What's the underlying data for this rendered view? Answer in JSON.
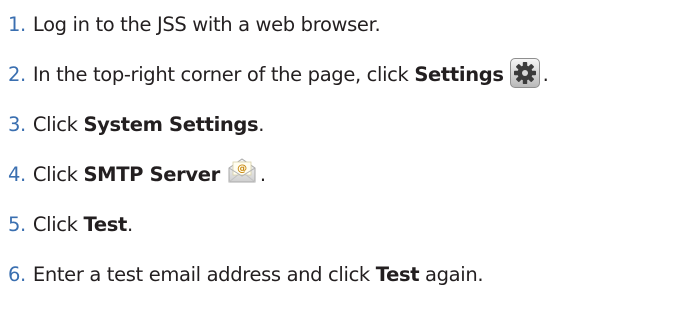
{
  "steps": [
    {
      "num": "1.",
      "parts": [
        "Log in to the JSS with a web browser."
      ]
    },
    {
      "num": "2.",
      "parts": [
        "In the top-right corner of the page, click ",
        "Settings",
        "."
      ]
    },
    {
      "num": "3.",
      "parts": [
        "Click ",
        "System Settings",
        "."
      ]
    },
    {
      "num": "4.",
      "parts": [
        "Click ",
        "SMTP Server",
        "."
      ]
    },
    {
      "num": "5.",
      "parts": [
        "Click ",
        "Test",
        "."
      ]
    },
    {
      "num": "6.",
      "parts": [
        "Enter a test email address and click ",
        "Test",
        " again."
      ]
    }
  ],
  "icons": {
    "settings": "gear-icon",
    "smtp": "envelope-icon"
  },
  "colors": {
    "step_number": "#3a6fb0",
    "text": "#231f20"
  }
}
